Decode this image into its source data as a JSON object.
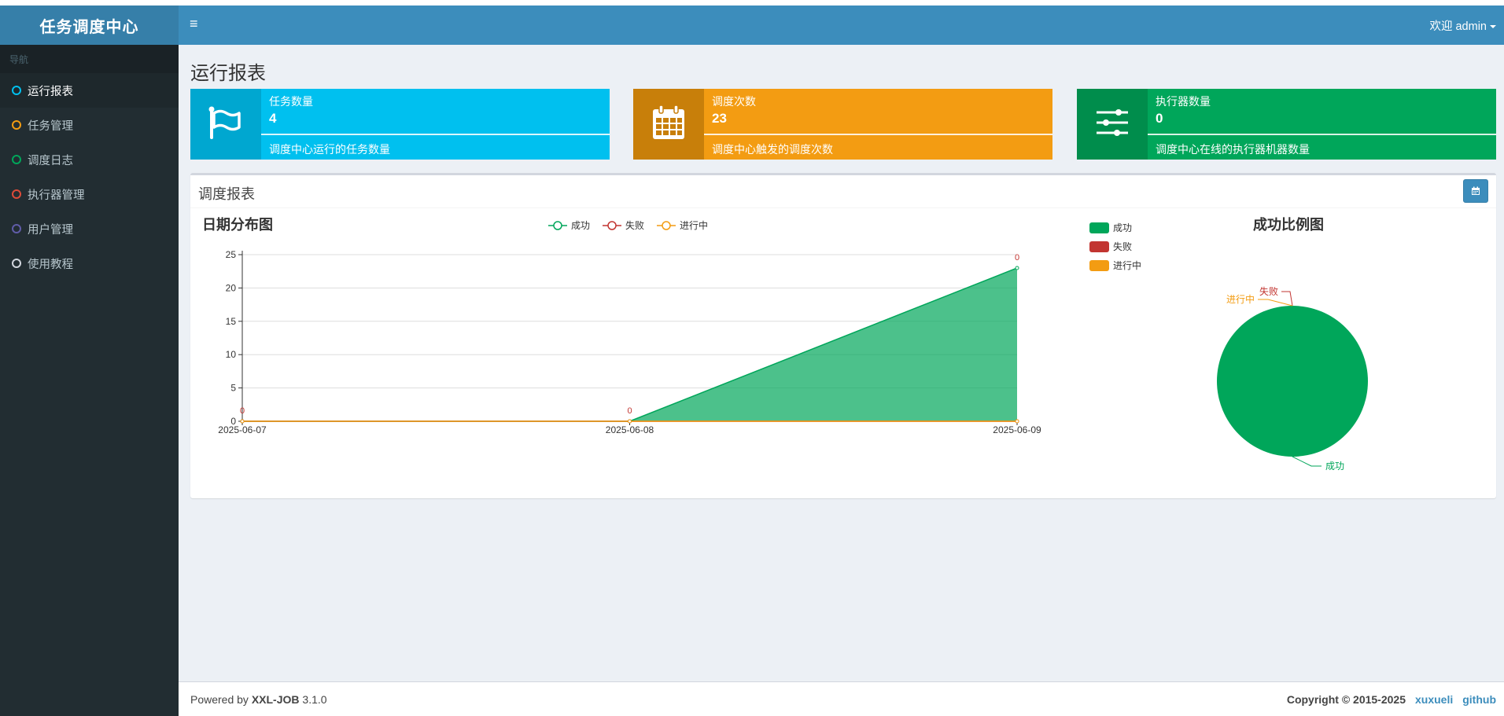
{
  "app": {
    "logo": "任务调度中心"
  },
  "sidebar": {
    "header": "导航",
    "items": [
      {
        "label": "运行报表",
        "color": "#00c0ef"
      },
      {
        "label": "任务管理",
        "color": "#f39c12"
      },
      {
        "label": "调度日志",
        "color": "#00a65a"
      },
      {
        "label": "执行器管理",
        "color": "#dd4b39"
      },
      {
        "label": "用户管理",
        "color": "#605ca8"
      },
      {
        "label": "使用教程",
        "color": "#d2d6de"
      }
    ]
  },
  "header": {
    "toggle_icon": "≡",
    "user_label": "欢迎 admin"
  },
  "page": {
    "title": "运行报表"
  },
  "info_boxes": [
    {
      "label": "任务数量",
      "value": "4",
      "desc": "调度中心运行的任务数量",
      "icon": "flag-icon",
      "bg": "#00c0ef",
      "icon_bg": "#00a7d0"
    },
    {
      "label": "调度次数",
      "value": "23",
      "desc": "调度中心触发的调度次数",
      "icon": "calendar-icon",
      "bg": "#f39c12",
      "icon_bg": "#c87f0a"
    },
    {
      "label": "执行器数量",
      "value": "0",
      "desc": "调度中心在线的执行器机器数量",
      "icon": "sliders-icon",
      "bg": "#00a65a",
      "icon_bg": "#008d4c"
    }
  ],
  "report": {
    "title": "调度报表",
    "date_button_icon": "calendar-icon"
  },
  "chart_data": [
    {
      "type": "area",
      "title": "日期分布图",
      "x": [
        "2025-06-07",
        "2025-06-08",
        "2025-06-09"
      ],
      "ylim": [
        0,
        25
      ],
      "yticks": [
        "0",
        "5",
        "10",
        "15",
        "20",
        "25"
      ],
      "series": [
        {
          "name": "成功",
          "values": [
            0,
            0,
            23
          ],
          "color": "#00a65a"
        },
        {
          "name": "失败",
          "values": [
            0,
            0,
            0
          ],
          "color": "#c23531"
        },
        {
          "name": "进行中",
          "values": [
            0,
            0,
            0
          ],
          "color": "#f39c12"
        }
      ],
      "data_labels": [
        "0",
        "0",
        "0"
      ],
      "grid": true,
      "legend": "top-center"
    },
    {
      "type": "pie",
      "title": "成功比例图",
      "slices": [
        {
          "name": "成功",
          "value": 23,
          "color": "#00a65a"
        },
        {
          "name": "失败",
          "value": 0,
          "color": "#c23531"
        },
        {
          "name": "进行中",
          "value": 0,
          "color": "#f39c12"
        }
      ],
      "legend": "top-left"
    }
  ],
  "footer": {
    "powered_prefix": "Powered by ",
    "powered_name": "XXL-JOB",
    "version": " 3.1.0",
    "copyright": "Copyright © 2015-2025",
    "link1": "xuxueli",
    "link2": "github"
  }
}
